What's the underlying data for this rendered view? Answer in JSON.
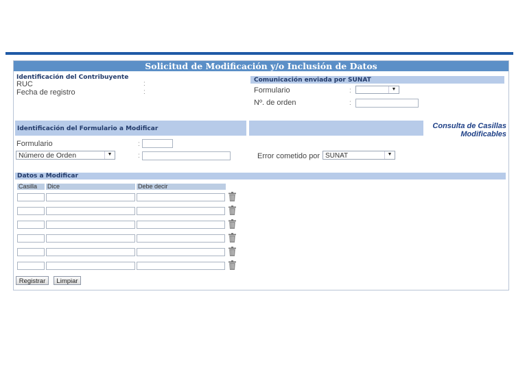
{
  "form": {
    "title": "Solicitud de Modificación y/o Inclusión de Datos"
  },
  "contribuyente": {
    "title": "Identificación del Contribuyente",
    "ruc_label": "RUC",
    "fecha_label": "Fecha de registro",
    "colon": ":"
  },
  "comunicacion": {
    "title": "Comunicación enviada por SUNAT",
    "formulario_label": "Formulario",
    "orden_label": "Nº. de orden",
    "colon": ":",
    "formulario_value": ""
  },
  "formulario_mod": {
    "title": "Identificación del Formulario a Modificar",
    "formulario_label": "Formulario",
    "orden_select_value": "Número de Orden",
    "colon": ":",
    "error_label": "Error cometido por :",
    "error_value": "SUNAT"
  },
  "consulta_link": {
    "line1": "Consulta de Casillas",
    "line2": "Modificables"
  },
  "datos": {
    "title": "Datos a Modificar",
    "headers": [
      "Casilla",
      "Dice",
      "Debe decir"
    ],
    "row_count": 6
  },
  "buttons": {
    "registrar": "Registrar",
    "limpiar": "Limpiar"
  },
  "colors": {
    "accent": "#1f5aa6",
    "title_bar": "#5b8fc7",
    "section_bar": "#b7cbe9",
    "link": "#1d3f86"
  }
}
